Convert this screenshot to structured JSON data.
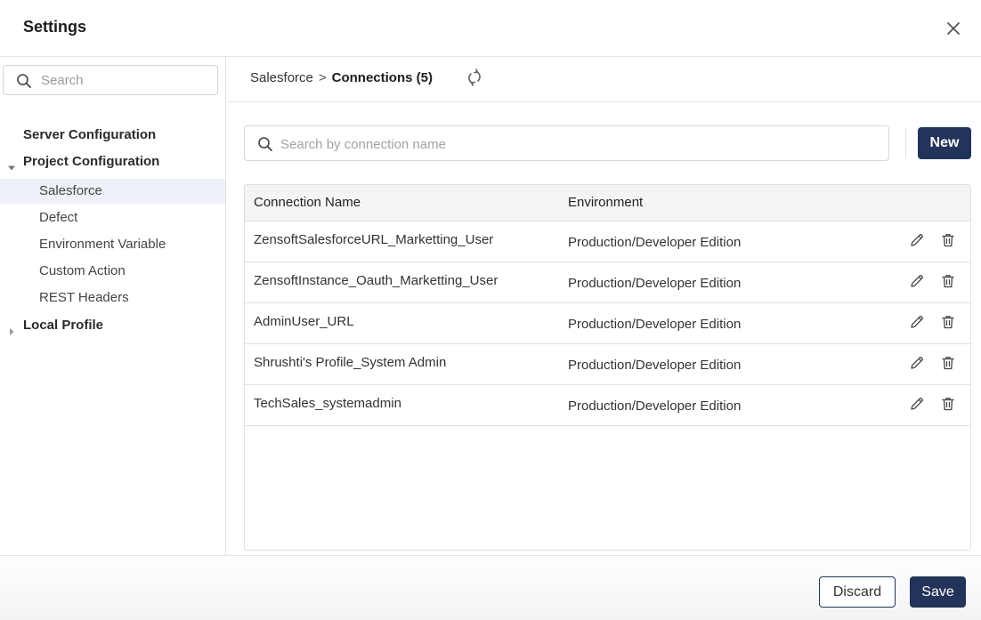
{
  "dialog": {
    "title": "Settings",
    "close_icon": "close-icon"
  },
  "sidebar": {
    "search_placeholder": "Search",
    "groups": [
      {
        "label": "Server Configuration",
        "expanded": null
      },
      {
        "label": "Project Configuration",
        "expanded": true
      },
      {
        "label": "Local Profile",
        "expanded": false
      }
    ],
    "items": [
      {
        "label": "Salesforce",
        "active": true
      },
      {
        "label": "Defect",
        "active": false
      },
      {
        "label": "Environment Variable",
        "active": false
      },
      {
        "label": "Custom Action",
        "active": false
      },
      {
        "label": "REST Headers",
        "active": false
      }
    ]
  },
  "breadcrumb": {
    "parent": "Salesforce",
    "separator": ">",
    "current": "Connections (5)"
  },
  "connections": {
    "search_placeholder": "Search by connection name",
    "new_label": "New",
    "columns": [
      "Connection Name",
      "Environment"
    ],
    "rows": [
      {
        "name": "ZensoftSalesforceURL_Marketting_User",
        "environment": "Production/Developer Edition"
      },
      {
        "name": "ZensoftInstance_Oauth_Marketting_User",
        "environment": "Production/Developer Edition"
      },
      {
        "name": "AdminUser_URL",
        "environment": "Production/Developer Edition"
      },
      {
        "name": "Shrushti's Profile_System Admin",
        "environment": "Production/Developer Edition"
      },
      {
        "name": "TechSales_systemadmin",
        "environment": "Production/Developer Edition"
      }
    ]
  },
  "footer": {
    "discard_label": "Discard",
    "save_label": "Save"
  },
  "colors": {
    "primary": "#23345a",
    "active_item_bg": "#eef1f7",
    "border": "#e3e3e3"
  }
}
